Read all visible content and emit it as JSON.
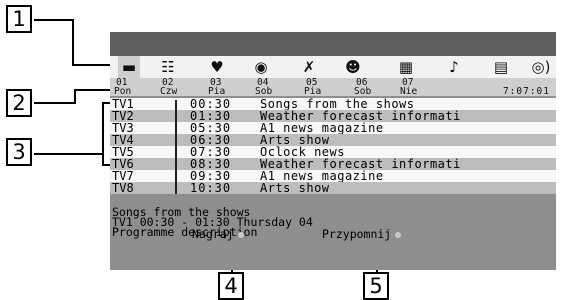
{
  "callouts": {
    "c1": "1",
    "c2": "2",
    "c3": "3",
    "c4": "4",
    "c5": "5"
  },
  "icons": [
    {
      "name": "tv-icon",
      "glyph": "▬"
    },
    {
      "name": "news-icon",
      "glyph": "☷"
    },
    {
      "name": "heart-icon",
      "glyph": "♥"
    },
    {
      "name": "palette-icon",
      "glyph": "◉"
    },
    {
      "name": "sport-icon",
      "glyph": "✗"
    },
    {
      "name": "kids-icon",
      "glyph": "☻"
    },
    {
      "name": "film-icon",
      "glyph": "▦"
    },
    {
      "name": "music-icon",
      "glyph": "♪"
    },
    {
      "name": "document-icon",
      "glyph": "▤"
    },
    {
      "name": "radio-icon",
      "glyph": "◎)"
    }
  ],
  "dates": [
    {
      "num": "01",
      "day": "Pon"
    },
    {
      "num": "02",
      "day": "Czw"
    },
    {
      "num": "03",
      "day": "Pia"
    },
    {
      "num": "04",
      "day": "Sob"
    },
    {
      "num": "05",
      "day": "Pia"
    },
    {
      "num": "06",
      "day": "Sob"
    },
    {
      "num": "07",
      "day": "Nie"
    }
  ],
  "clock": "7:07:01",
  "programmes": [
    {
      "channel": "TV1",
      "time": "00:30",
      "title": "Songs from the shows"
    },
    {
      "channel": "TV2",
      "time": "01:30",
      "title": "Weather forecast informati"
    },
    {
      "channel": "TV3",
      "time": "05:30",
      "title": "A1 news magazine"
    },
    {
      "channel": "TV4",
      "time": "06:30",
      "title": "Arts show"
    },
    {
      "channel": "TV5",
      "time": "07:30",
      "title": "Oclock news"
    },
    {
      "channel": "TV6",
      "time": "08:30",
      "title": "Weather forecast informati"
    },
    {
      "channel": "TV7",
      "time": "09:30",
      "title": "A1 news magazine"
    },
    {
      "channel": "TV8",
      "time": "10:30",
      "title": "Arts show"
    }
  ],
  "info": {
    "title": "Songs from the shows",
    "detail": "TV1 00:30 - 01:30 Thursday  04",
    "description": "Programme description"
  },
  "buttons": {
    "record": "Nagraj",
    "remind": "Przypomnij"
  }
}
